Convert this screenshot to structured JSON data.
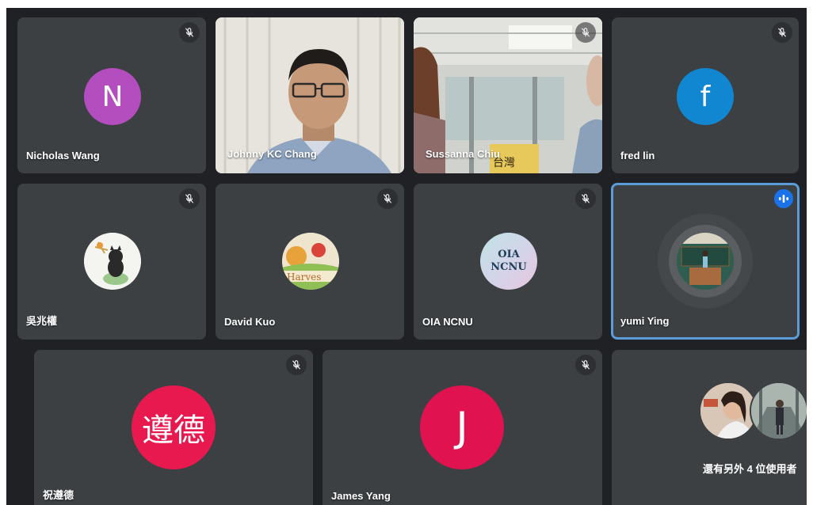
{
  "participants": [
    {
      "name": "Nicholas Wang",
      "initial": "N",
      "avatar_color": "#b44dbd",
      "muted": true
    },
    {
      "name": "Johnny KC Chang",
      "camera_on": true,
      "muted": false
    },
    {
      "name": "Sussanna Chiu",
      "camera_on": true,
      "muted": true
    },
    {
      "name": "fred lin",
      "initial": "f",
      "avatar_color": "#1187d1",
      "muted": true
    },
    {
      "name": "吳兆權",
      "avatar": "cartoon-photo",
      "muted": true
    },
    {
      "name": "David Kuo",
      "avatar": "logo-photo",
      "logo_text": "Harves",
      "muted": true
    },
    {
      "name": "OIA NCNU",
      "avatar_lines": [
        "OIA",
        "NCNU"
      ],
      "muted": true
    },
    {
      "name": "yumi Ying",
      "avatar": "photo",
      "speaking": true
    },
    {
      "name": "祝遵德",
      "initial": "遵德",
      "avatar_color": "#e8194f",
      "muted": true
    },
    {
      "name": "James Yang",
      "initial": "J",
      "avatar_color": "#e0124f",
      "muted": true
    }
  ],
  "others": {
    "label": "還有另外 4 位使用者"
  },
  "colors": {
    "tile": "#3c4043",
    "background": "#202124",
    "speaking_border": "#5b9bd8",
    "speaking_badge": "#1a73e8"
  }
}
